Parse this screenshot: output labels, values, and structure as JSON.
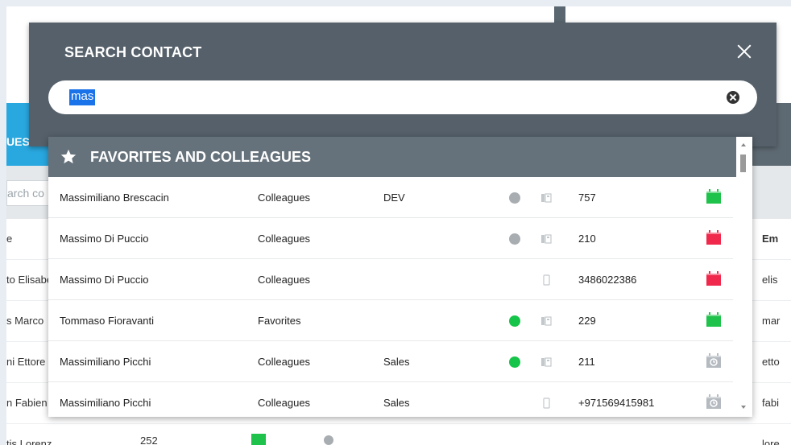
{
  "background": {
    "tab_label": "UES",
    "search_placeholder": "arch co",
    "left_column_cells": [
      "e",
      "to Elisabe",
      "s Marco",
      "ni Ettore",
      "n Fabien",
      "tis Lorenzo"
    ],
    "right_column_header": "Em",
    "right_column_cells": [
      "elis",
      "mar",
      "etto",
      "fabi",
      "lore"
    ],
    "bottom_row_number": "252"
  },
  "modal": {
    "title": "SEARCH CONTACT",
    "search_value": "mas"
  },
  "results": {
    "section_title": "FAVORITES AND COLLEAGUES",
    "rows": [
      {
        "name": "Massimiliano Brescacin",
        "group": "Colleagues",
        "dept": "DEV",
        "status": "grey",
        "device": "deskphone",
        "number": "757",
        "calendar": "green"
      },
      {
        "name": "Massimo Di Puccio",
        "group": "Colleagues",
        "dept": "",
        "status": "grey",
        "device": "deskphone",
        "number": "210",
        "calendar": "red"
      },
      {
        "name": "Massimo Di Puccio",
        "group": "Colleagues",
        "dept": "",
        "status": "none",
        "device": "mobile",
        "number": "3486022386",
        "calendar": "red"
      },
      {
        "name": "Tommaso Fioravanti",
        "group": "Favorites",
        "dept": "",
        "status": "green",
        "device": "deskphone",
        "number": "229",
        "calendar": "green"
      },
      {
        "name": "Massimiliano Picchi",
        "group": "Colleagues",
        "dept": "Sales",
        "status": "green",
        "device": "deskphone",
        "number": "211",
        "calendar": "grey"
      },
      {
        "name": "Massimiliano Picchi",
        "group": "Colleagues",
        "dept": "Sales",
        "status": "none",
        "device": "mobile",
        "number": "+971569415981",
        "calendar": "grey"
      }
    ]
  },
  "colors": {
    "modal_bg": "#55606a",
    "header_bg": "#66727b",
    "status_green": "#17c44a",
    "status_grey": "#a8adb1",
    "cal_green": "#1fc24a",
    "cal_red": "#f0284b",
    "cal_grey": "#b4bac0",
    "accent_blue": "#29a8e0"
  }
}
